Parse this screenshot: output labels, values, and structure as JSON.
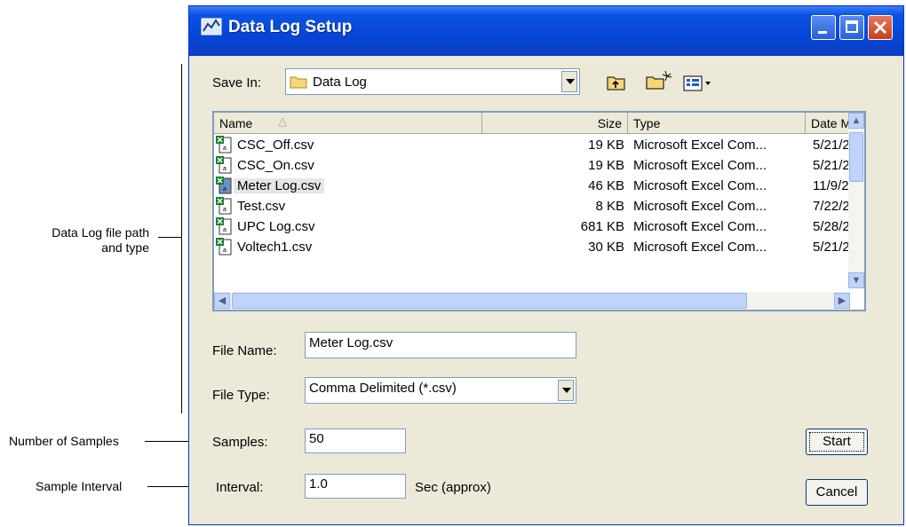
{
  "annotations": {
    "file_path": "Data Log file path\nand type",
    "samples": "Number of Samples",
    "interval": "Sample Interval"
  },
  "window": {
    "title": "Data Log Setup",
    "icon": "app-icon"
  },
  "save_in": {
    "label": "Save In:",
    "value": "Data Log"
  },
  "toolbar": {
    "up_icon": "up-folder-icon",
    "new_folder_icon": "new-folder-icon",
    "view_icon": "view-menu-icon"
  },
  "list": {
    "headers": [
      "Name",
      "Size",
      "Type",
      "Date M"
    ],
    "rows": [
      {
        "name": "CSC_Off.csv",
        "size": "19 KB",
        "type": "Microsoft Excel Com...",
        "date": "5/21/2"
      },
      {
        "name": "CSC_On.csv",
        "size": "19 KB",
        "type": "Microsoft Excel Com...",
        "date": "5/21/2"
      },
      {
        "name": "Meter Log.csv",
        "size": "46 KB",
        "type": "Microsoft Excel Com...",
        "date": "11/9/2"
      },
      {
        "name": "Test.csv",
        "size": "8 KB",
        "type": "Microsoft Excel Com...",
        "date": "7/22/2"
      },
      {
        "name": "UPC Log.csv",
        "size": "681 KB",
        "type": "Microsoft Excel Com...",
        "date": "5/28/2"
      },
      {
        "name": "Voltech1.csv",
        "size": "30 KB",
        "type": "Microsoft Excel Com...",
        "date": "5/21/2"
      }
    ],
    "selected_index": 2
  },
  "file_name": {
    "label": "File Name:",
    "value": "Meter Log.csv"
  },
  "file_type": {
    "label": "File Type:",
    "value": "Comma Delimited (*.csv)"
  },
  "samples": {
    "label": "Samples:",
    "value": "50"
  },
  "interval": {
    "label": "Interval:",
    "value": "1.0",
    "unit": "Sec (approx)"
  },
  "buttons": {
    "start": "Start",
    "cancel": "Cancel"
  },
  "colors": {
    "titlebar": "#0a53e2",
    "face": "#ece9d8",
    "border": "#7f9db9"
  }
}
